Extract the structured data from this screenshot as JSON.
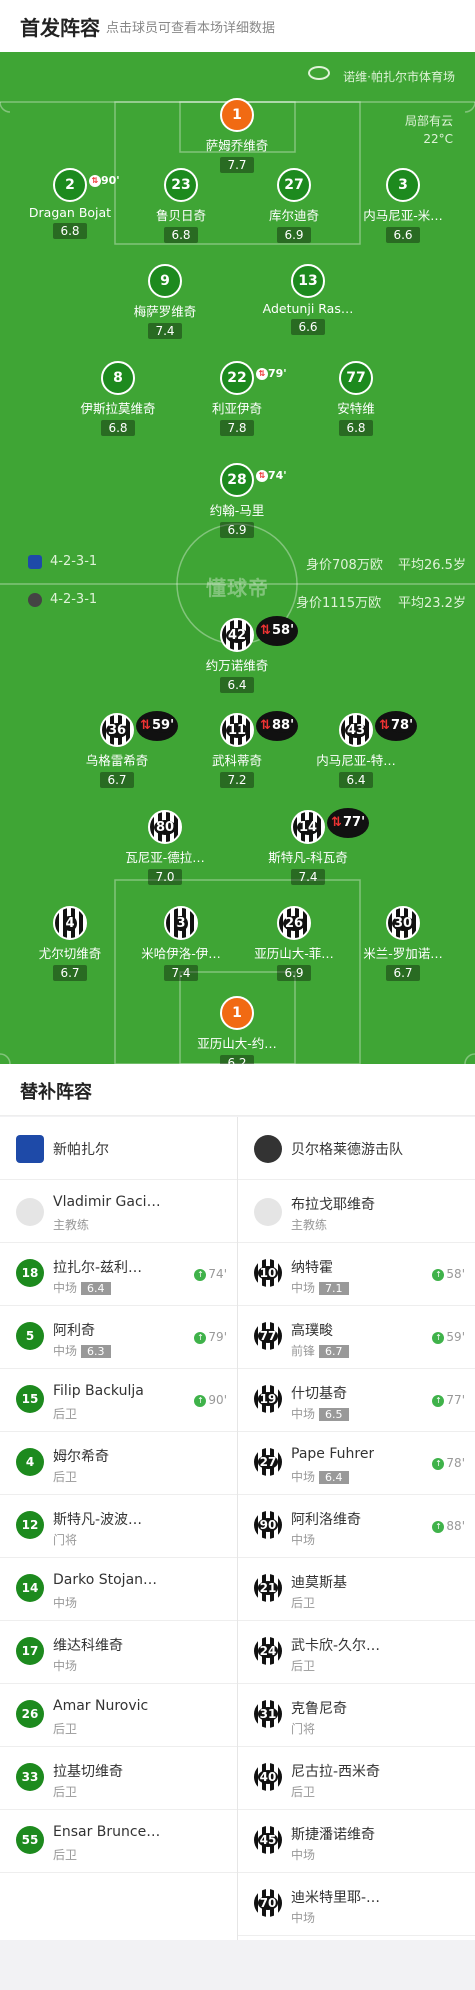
{
  "header": {
    "title": "首发阵容",
    "subtitle": "点击球员可查看本场详细数据"
  },
  "pitch": {
    "stadium": "诺维·帕扎尔市体育场",
    "weather": "局部有云",
    "temp": "22°C",
    "watermark": "懂球帝",
    "home": {
      "formation": "4-2-3-1",
      "value": "身价708万欧",
      "age": "平均26.5岁"
    },
    "away": {
      "formation": "4-2-3-1",
      "value": "身价1115万欧",
      "age": "平均23.2岁"
    }
  },
  "home_players": [
    {
      "num": "1",
      "name": "萨姆乔维奇",
      "rating": "7.7",
      "gk": true
    },
    {
      "num": "2",
      "name": "Dragan Bojat",
      "rating": "6.8",
      "badge": "90'"
    },
    {
      "num": "23",
      "name": "鲁贝日奇",
      "rating": "6.8"
    },
    {
      "num": "27",
      "name": "库尔迪奇",
      "rating": "6.9"
    },
    {
      "num": "3",
      "name": "内马尼亚-米…",
      "rating": "6.6"
    },
    {
      "num": "9",
      "name": "梅萨罗维奇",
      "rating": "7.4"
    },
    {
      "num": "13",
      "name": "Adetunji Ras…",
      "rating": "6.6"
    },
    {
      "num": "8",
      "name": "伊斯拉莫维奇",
      "rating": "6.8"
    },
    {
      "num": "22",
      "name": "利亚伊奇",
      "rating": "7.8",
      "badge": "79'"
    },
    {
      "num": "77",
      "name": "安特维",
      "rating": "6.8"
    },
    {
      "num": "28",
      "name": "约翰-马里",
      "rating": "6.9",
      "badge": "74'"
    }
  ],
  "away_players": [
    {
      "num": "42",
      "name": "约万诺维奇",
      "rating": "6.4",
      "badge": "58'"
    },
    {
      "num": "36",
      "name": "乌格雷希奇",
      "rating": "6.7",
      "badge": "59'"
    },
    {
      "num": "11",
      "name": "武科蒂奇",
      "rating": "7.2",
      "badge": "88'"
    },
    {
      "num": "43",
      "name": "内马尼亚-特…",
      "rating": "6.4",
      "badge": "78'"
    },
    {
      "num": "80",
      "name": "瓦尼亚-德拉…",
      "rating": "7.0"
    },
    {
      "num": "14",
      "name": "斯特凡-科瓦奇",
      "rating": "7.4",
      "badge": "77'"
    },
    {
      "num": "4",
      "name": "尤尔切维奇",
      "rating": "6.7"
    },
    {
      "num": "3",
      "name": "米哈伊洛-伊…",
      "rating": "7.4"
    },
    {
      "num": "26",
      "name": "亚历山大-菲…",
      "rating": "6.9"
    },
    {
      "num": "30",
      "name": "米兰-罗加诺…",
      "rating": "6.7"
    },
    {
      "num": "1",
      "name": "亚历山大-约…",
      "rating": "6.2",
      "gk": true
    }
  ],
  "subs": {
    "title": "替补阵容",
    "home": {
      "team": "新帕扎尔",
      "coach": "Vladimir Gacinovic",
      "coach_role": "主教练",
      "list": [
        {
          "num": "18",
          "name": "拉扎尔-兹利…",
          "pos": "中场",
          "rating": "6.4",
          "evt": "74'"
        },
        {
          "num": "5",
          "name": "阿利奇",
          "pos": "中场",
          "rating": "6.3",
          "evt": "79'"
        },
        {
          "num": "15",
          "name": "Filip Backulja",
          "pos": "后卫",
          "rating": "",
          "evt": "90'"
        },
        {
          "num": "4",
          "name": "姆尔希奇",
          "pos": "后卫",
          "rating": "",
          "evt": ""
        },
        {
          "num": "12",
          "name": "斯特凡-波波…",
          "pos": "门将",
          "rating": "",
          "evt": ""
        },
        {
          "num": "14",
          "name": "Darko Stojan…",
          "pos": "中场",
          "rating": "",
          "evt": ""
        },
        {
          "num": "17",
          "name": "维达科维奇",
          "pos": "中场",
          "rating": "",
          "evt": ""
        },
        {
          "num": "26",
          "name": "Amar Nurovic",
          "pos": "后卫",
          "rating": "",
          "evt": ""
        },
        {
          "num": "33",
          "name": "拉基切维奇",
          "pos": "后卫",
          "rating": "",
          "evt": ""
        },
        {
          "num": "55",
          "name": "Ensar Brunce…",
          "pos": "后卫",
          "rating": "",
          "evt": ""
        }
      ]
    },
    "away": {
      "team": "贝尔格莱德游击队",
      "coach": "布拉戈耶维奇",
      "coach_role": "主教练",
      "list": [
        {
          "num": "10",
          "name": "纳特霍",
          "pos": "中场",
          "rating": "7.1",
          "evt": "58'"
        },
        {
          "num": "77",
          "name": "高璞畯",
          "pos": "前锋",
          "rating": "6.7",
          "evt": "59'"
        },
        {
          "num": "19",
          "name": "什切基奇",
          "pos": "中场",
          "rating": "6.5",
          "evt": "77'"
        },
        {
          "num": "27",
          "name": "Pape Fuhrer",
          "pos": "中场",
          "rating": "6.4",
          "evt": "78'"
        },
        {
          "num": "90",
          "name": "阿利洛维奇",
          "pos": "中场",
          "rating": "",
          "evt": "88'"
        },
        {
          "num": "21",
          "name": "迪莫斯基",
          "pos": "后卫",
          "rating": "",
          "evt": ""
        },
        {
          "num": "24",
          "name": "武卡欣-久尔…",
          "pos": "后卫",
          "rating": "",
          "evt": ""
        },
        {
          "num": "31",
          "name": "克鲁尼奇",
          "pos": "门将",
          "rating": "",
          "evt": ""
        },
        {
          "num": "40",
          "name": "尼古拉-西米奇",
          "pos": "后卫",
          "rating": "",
          "evt": ""
        },
        {
          "num": "45",
          "name": "斯捷潘诺维奇",
          "pos": "中场",
          "rating": "",
          "evt": ""
        },
        {
          "num": "70",
          "name": "迪米特里耶-…",
          "pos": "中场",
          "rating": "",
          "evt": ""
        }
      ]
    }
  }
}
